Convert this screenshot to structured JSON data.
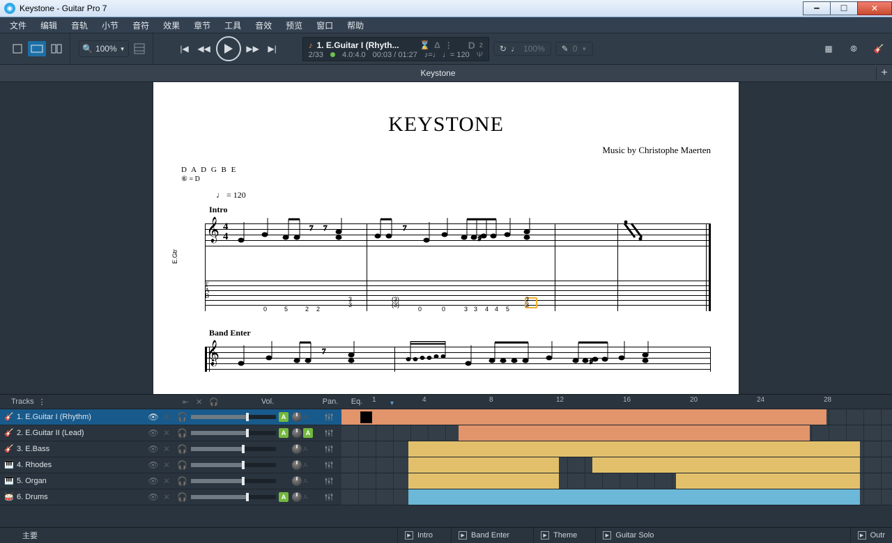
{
  "titlebar": {
    "text": "Keystone - Guitar Pro 7"
  },
  "menu": [
    "文件",
    "编辑",
    "音轨",
    "小节",
    "音符",
    "效果",
    "章节",
    "工具",
    "音效",
    "预览",
    "窗口",
    "帮助"
  ],
  "toolbar": {
    "zoom": "100%",
    "track_label": "1. E.Guitar I (Rhyth...",
    "position": "2/33",
    "ts_text": "4.0:4.0",
    "time": "00:03 / 01:27",
    "tempo_eq": "♪=♩ ♩= 120",
    "d_label": "D",
    "d_val": "2",
    "loop_pct": "100%",
    "pitch_val": "0"
  },
  "tab": {
    "title": "Keystone"
  },
  "score": {
    "title": "KEYSTONE",
    "credit": "Music by Christophe Maerten",
    "tuning": "D A D G B E",
    "tuning2": "⑥ = D",
    "tempo": "♩ = 120",
    "section1": "Intro",
    "section2": "Band Enter",
    "instrument": "E.Gtr",
    "tab_nums_bar1": [
      "0",
      "5",
      "2",
      "2",
      "3",
      "3"
    ],
    "tab_nums_bar2": [
      "(3)",
      "(3)",
      "0",
      "0",
      "3",
      "3",
      "4",
      "4",
      "5",
      "3",
      "3"
    ]
  },
  "tracks_header": {
    "title": "Tracks",
    "vol": "Vol.",
    "pan": "Pan.",
    "eq": "Eq."
  },
  "ruler_ticks": [
    1,
    4,
    8,
    12,
    16,
    20,
    24,
    28
  ],
  "tracks": [
    {
      "n": "1. E.Guitar I (Rhythm)",
      "sel": true,
      "vol": 65,
      "auto": true,
      "panAuto": false,
      "blocks": [
        {
          "c": "or",
          "s": 0,
          "e": 696
        }
      ]
    },
    {
      "n": "2. E.Guitar II (Lead)",
      "sel": false,
      "vol": 65,
      "auto": true,
      "panAuto": true,
      "blocks": [
        {
          "c": "or",
          "s": 168,
          "e": 672
        }
      ]
    },
    {
      "n": "3. E.Bass",
      "sel": false,
      "vol": 60,
      "auto": false,
      "panAuto": false,
      "blocks": [
        {
          "c": "ye",
          "s": 96,
          "e": 744
        }
      ]
    },
    {
      "n": "4. Rhodes",
      "sel": false,
      "vol": 60,
      "auto": false,
      "panAuto": false,
      "blocks": [
        {
          "c": "ye",
          "s": 96,
          "e": 312
        },
        {
          "c": "ye",
          "s": 360,
          "e": 744
        }
      ]
    },
    {
      "n": "5. Organ",
      "sel": false,
      "vol": 60,
      "auto": false,
      "panAuto": false,
      "blocks": [
        {
          "c": "ye",
          "s": 96,
          "e": 312
        },
        {
          "c": "ye",
          "s": 480,
          "e": 744
        }
      ]
    },
    {
      "n": "6. Drums",
      "sel": false,
      "vol": 65,
      "auto": true,
      "panAuto": false,
      "blocks": [
        {
          "c": "bl",
          "s": 96,
          "e": 744
        }
      ]
    }
  ],
  "sections": [
    "Intro",
    "Band Enter",
    "Theme",
    "Guitar Solo"
  ],
  "section_right": "Outr",
  "main_label": "主要"
}
